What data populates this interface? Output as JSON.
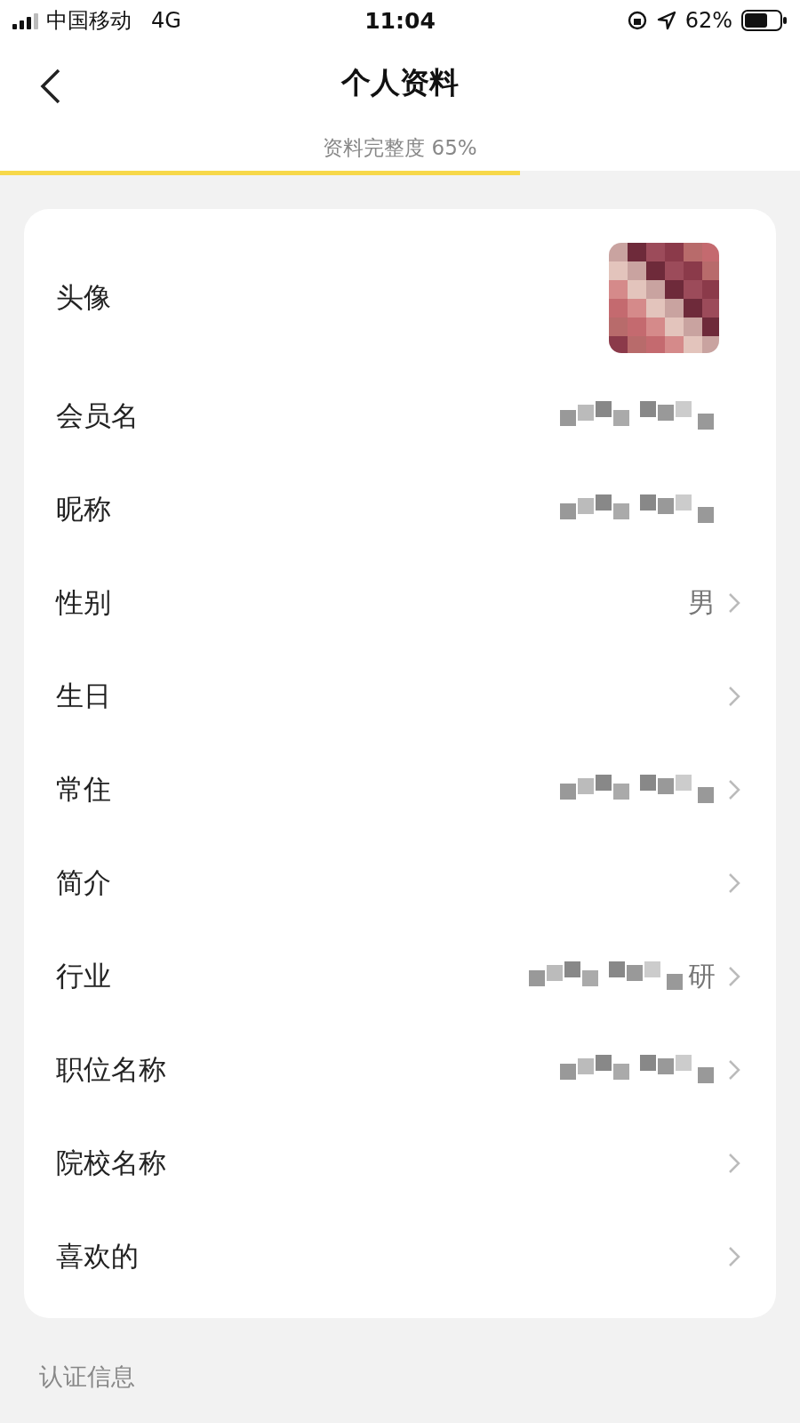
{
  "status_bar": {
    "carrier": "中国移动",
    "network": "4G",
    "time": "11:04",
    "battery": "62%"
  },
  "header": {
    "title": "个人资料"
  },
  "completeness": {
    "label": "资料完整度 65%",
    "level": 0.65
  },
  "rows": [
    {
      "kind": "avatar",
      "label": "头像",
      "masked": false,
      "arrow": false
    },
    {
      "kind": "text",
      "label": "会员名",
      "masked": true,
      "arrow": false
    },
    {
      "kind": "text",
      "label": "昵称",
      "masked": true,
      "arrow": false
    },
    {
      "kind": "text",
      "label": "性别",
      "value": "男",
      "masked": false,
      "arrow": true
    },
    {
      "kind": "text",
      "label": "生日",
      "masked": false,
      "arrow": true
    },
    {
      "kind": "text",
      "label": "常住",
      "masked": true,
      "arrow": true
    },
    {
      "kind": "text",
      "label": "简介",
      "masked": false,
      "arrow": true
    },
    {
      "kind": "text",
      "label": "行业",
      "value": "研",
      "masked": true,
      "arrow": true
    },
    {
      "kind": "text",
      "label": "职位名称",
      "masked": true,
      "arrow": true
    },
    {
      "kind": "text",
      "label": "院校名称",
      "masked": false,
      "arrow": true
    },
    {
      "kind": "text",
      "label": "喜欢的",
      "masked": false,
      "arrow": true
    }
  ],
  "section": {
    "title": "认证信息"
  }
}
